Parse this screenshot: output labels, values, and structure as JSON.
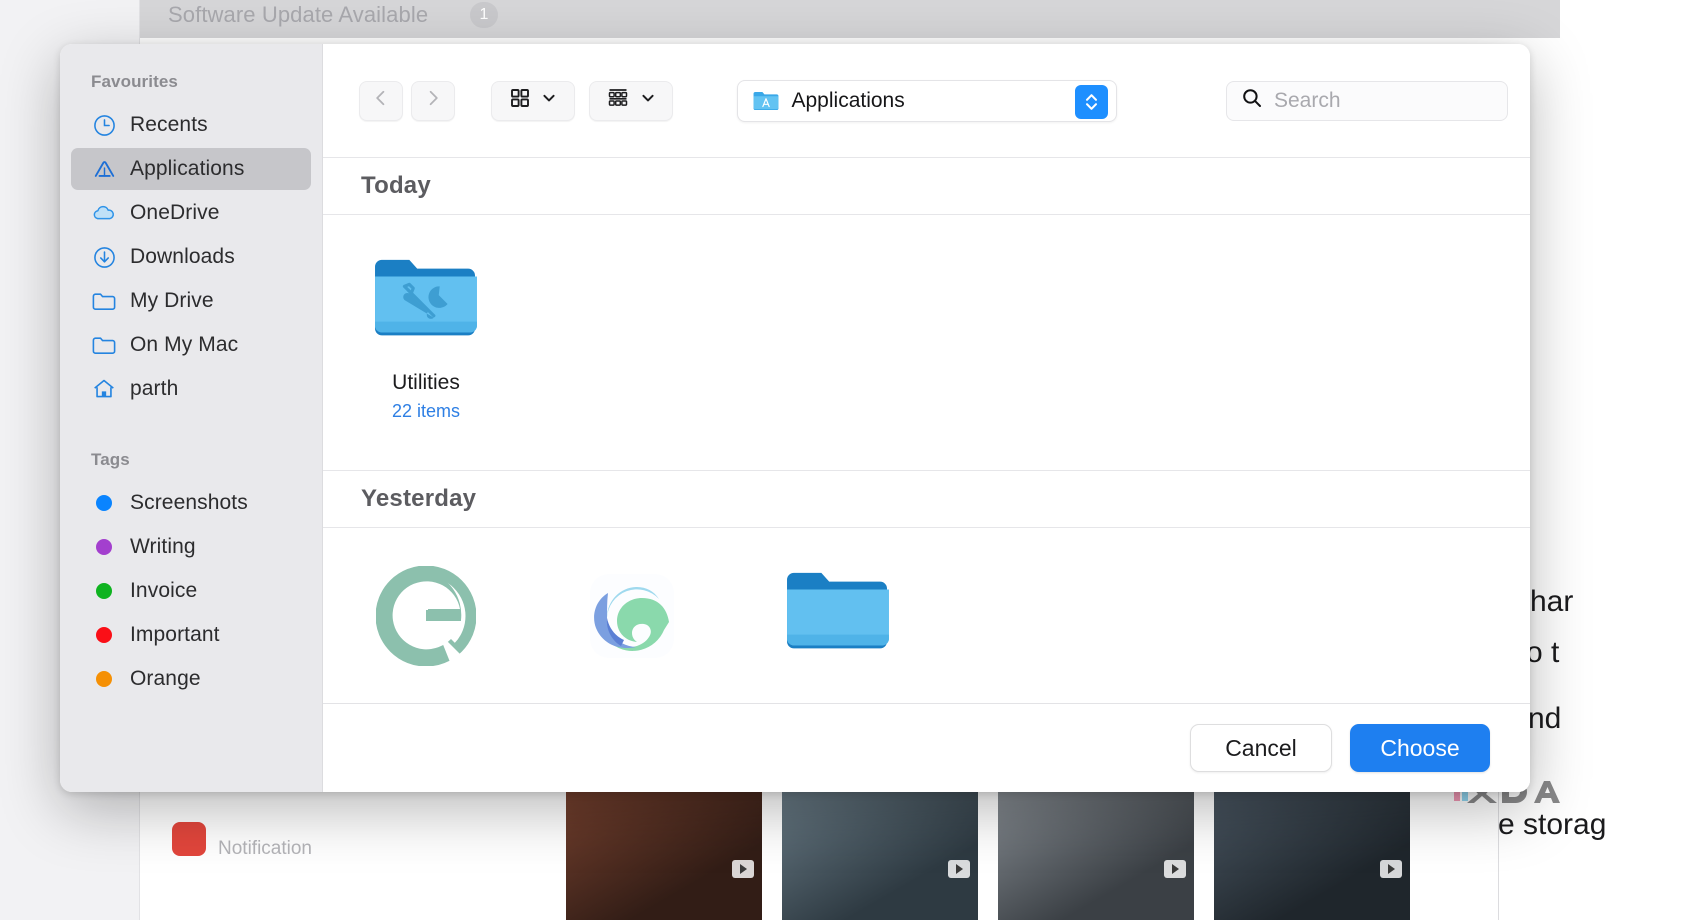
{
  "background": {
    "update_text": "Software Update Available",
    "update_badge": "1",
    "right_fragments": [
      "har",
      "o t",
      "nd",
      "e storag"
    ],
    "notification_text": "Notification"
  },
  "sidebar": {
    "favourites_header": "Favourites",
    "favourites": [
      {
        "label": "Recents",
        "icon": "clock-icon",
        "selected": false
      },
      {
        "label": "Applications",
        "icon": "applications-icon",
        "selected": true
      },
      {
        "label": "OneDrive",
        "icon": "cloud-icon",
        "selected": false
      },
      {
        "label": "Downloads",
        "icon": "download-icon",
        "selected": false
      },
      {
        "label": "My Drive",
        "icon": "folder-icon",
        "selected": false
      },
      {
        "label": "On My Mac",
        "icon": "folder-icon",
        "selected": false
      },
      {
        "label": "parth",
        "icon": "home-icon",
        "selected": false
      }
    ],
    "tags_header": "Tags",
    "tags": [
      {
        "label": "Screenshots",
        "color": "#0a84ff"
      },
      {
        "label": "Writing",
        "color": "#a33fce"
      },
      {
        "label": "Invoice",
        "color": "#0fb320"
      },
      {
        "label": "Important",
        "color": "#fa0f17"
      },
      {
        "label": "Orange",
        "color": "#f59005"
      }
    ]
  },
  "toolbar": {
    "back_icon": "chevron-left-icon",
    "forward_icon": "chevron-right-icon",
    "view_mode_icon": "grid-view-icon",
    "group_by_icon": "list-group-icon",
    "chevron_icon": "chevron-down-icon",
    "path_label": "Applications",
    "path_icon": "applications-folder-icon",
    "stepper_icon": "up-down-stepper-icon",
    "search_icon": "search-icon",
    "search_placeholder": "Search",
    "search_value": ""
  },
  "content": {
    "sections": [
      {
        "title": "Today",
        "items": [
          {
            "name": "Utilities",
            "subtitle": "22 items",
            "icon": "utilities-folder-icon"
          }
        ]
      },
      {
        "title": "Yesterday",
        "items": [
          {
            "name": "",
            "subtitle": "",
            "icon": "grammarly-app-icon"
          },
          {
            "name": "",
            "subtitle": "",
            "icon": "microsoft-edge-app-icon"
          },
          {
            "name": "",
            "subtitle": "",
            "icon": "blue-folder-icon"
          }
        ]
      }
    ]
  },
  "footer": {
    "cancel_label": "Cancel",
    "choose_label": "Choose"
  },
  "colors": {
    "accent": "#1e7ff0",
    "sidebar_bg": "#e9e9ec",
    "selected_row": "#c6c6ca",
    "subtitle_blue": "#2e7fe4"
  }
}
